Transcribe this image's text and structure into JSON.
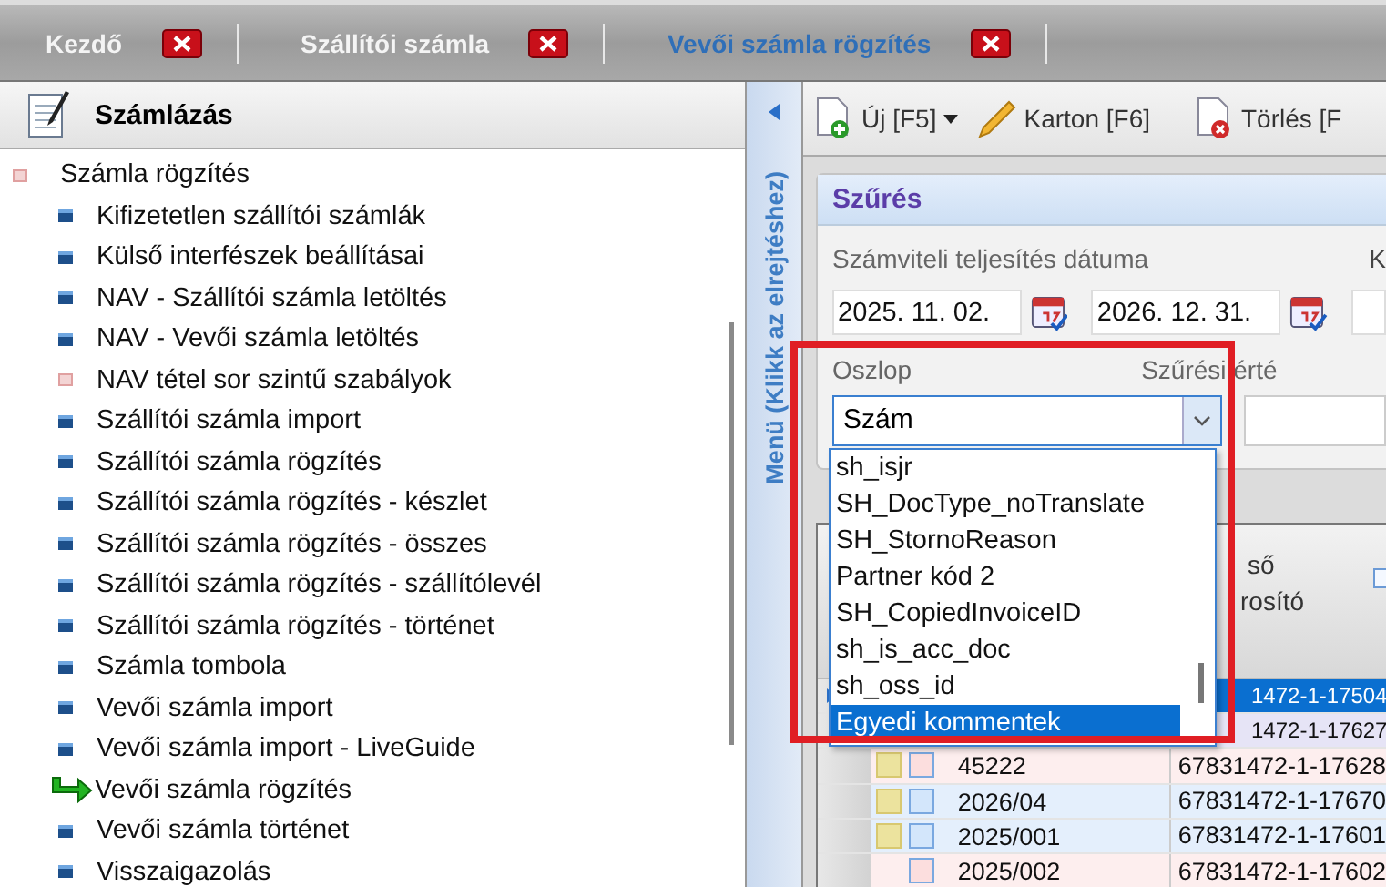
{
  "tabs": [
    {
      "label": "Kezdő",
      "selected": false
    },
    {
      "label": "Szállítói számla",
      "selected": false
    },
    {
      "label": "Vevői számla rögzítés",
      "selected": true
    }
  ],
  "sidebar": {
    "title": "Számlázás",
    "tree": [
      {
        "label": "Számla rögzítés",
        "kind": "group",
        "children": [
          {
            "label": "Kifizetetlen szállítói számlák",
            "kind": "doc"
          },
          {
            "label": "Külső interfészek beállításai",
            "kind": "doc"
          },
          {
            "label": "NAV - Szállítói számla letöltés",
            "kind": "doc"
          },
          {
            "label": "NAV - Vevői számla letöltés",
            "kind": "doc"
          },
          {
            "label": "NAV tétel sor szintű szabályok",
            "kind": "group"
          },
          {
            "label": "Szállítói számla import",
            "kind": "doc"
          },
          {
            "label": "Szállítói számla rögzítés",
            "kind": "doc"
          },
          {
            "label": "Szállítói számla rögzítés - készlet",
            "kind": "doc"
          },
          {
            "label": "Szállítói számla rögzítés - összes",
            "kind": "doc"
          },
          {
            "label": "Szállítói számla rögzítés - szállítólevél",
            "kind": "doc"
          },
          {
            "label": "Szállítói számla rögzítés - történet",
            "kind": "doc"
          },
          {
            "label": "Számla tombola",
            "kind": "doc"
          },
          {
            "label": "Vevői számla import",
            "kind": "doc"
          },
          {
            "label": "Vevői számla import - LiveGuide",
            "kind": "doc"
          },
          {
            "label": "Vevői számla rögzítés",
            "kind": "current"
          },
          {
            "label": "Vevői számla történet",
            "kind": "doc"
          },
          {
            "label": "Visszaigazolás",
            "kind": "doc"
          }
        ]
      }
    ]
  },
  "menu_strip": {
    "label": "Menü (Klikk az elrejtéshez)"
  },
  "toolbar": [
    {
      "label": "Új [F5]",
      "kind": "new",
      "dropdown": true
    },
    {
      "label": "Karton [F6]",
      "kind": "edit",
      "dropdown": false
    },
    {
      "label": "Törlés [F",
      "kind": "delete",
      "dropdown": false
    }
  ],
  "filter": {
    "title": "Szűrés",
    "date_label": "Számviteli teljesítés dátuma",
    "next_label": "K",
    "date_from": "2025. 11. 02.",
    "date_to": "2026. 12. 31.",
    "column_label": "Oszlop",
    "column_value": "Szám",
    "value_label": "Szűrési érté",
    "options": [
      {
        "label": "sh_isjr",
        "selected": false
      },
      {
        "label": "SH_DocType_noTranslate",
        "selected": false
      },
      {
        "label": "SH_StornoReason",
        "selected": false
      },
      {
        "label": "Partner kód 2",
        "selected": false
      },
      {
        "label": "SH_CopiedInvoiceID",
        "selected": false
      },
      {
        "label": "sh_is_acc_doc",
        "selected": false
      },
      {
        "label": "sh_oss_id",
        "selected": false
      },
      {
        "label": "Egyedi kommentek",
        "selected": true
      }
    ]
  },
  "table": {
    "header": [
      "ső",
      "rosító"
    ],
    "header_checkbox": {
      "checked": false
    },
    "rows": [
      {
        "id": "1472-1-17504",
        "selected": true
      },
      {
        "id": "1472-1-17627",
        "kind": "lavender",
        "selected": false
      },
      {
        "number": "45222",
        "id": "67831472-1-17628",
        "kind": "pink",
        "flag": true,
        "color": "#fcdede",
        "selected": false
      },
      {
        "number": "2026/04",
        "id": "67831472-1-17670",
        "kind": "blue",
        "flag": true,
        "color": "#d3e6fb",
        "selected": false
      },
      {
        "number": "2025/001",
        "id": "67831472-1-17601",
        "kind": "blue",
        "flag": true,
        "color": "#d3e6fb",
        "selected": false
      },
      {
        "number": "2025/002",
        "id": "67831472-1-17602",
        "kind": "pink",
        "flag": false,
        "color": "#fcdede",
        "selected": false
      }
    ]
  }
}
